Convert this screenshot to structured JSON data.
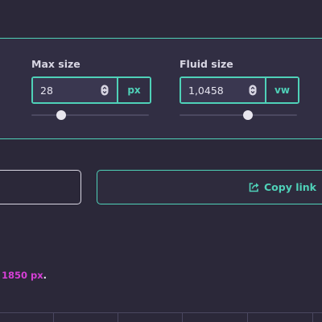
{
  "settings": {
    "max_size": {
      "label": "Max size",
      "value": "28",
      "unit": "px",
      "slider_fraction": 0.25
    },
    "fluid_size": {
      "label": "Fluid size",
      "value": "1,0458",
      "unit": "vw",
      "slider_fraction": 0.58
    }
  },
  "actions": {
    "left_button_label": "",
    "copy_link_label": "Copy link",
    "copy_link_icon": "share-icon"
  },
  "note": {
    "value": "1850 px",
    "suffix": "."
  },
  "colors": {
    "accent": "#4fd1b8",
    "highlight": "#d63fd6",
    "background": "#2b2839",
    "panel": "#312e43"
  }
}
